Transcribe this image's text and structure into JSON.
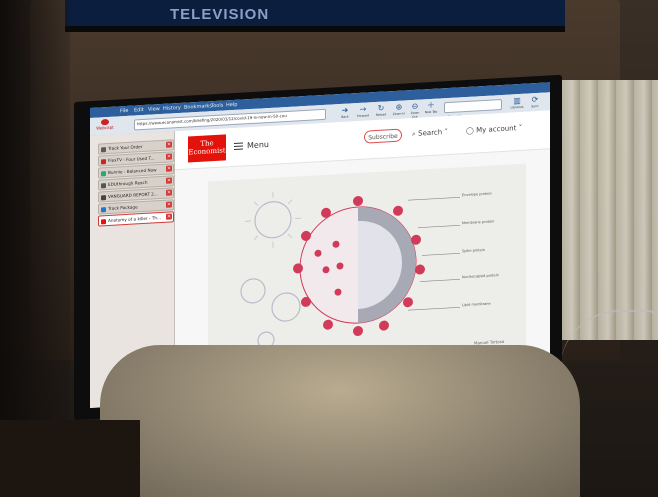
{
  "scene": {
    "tv_banner": "TELEVISION"
  },
  "browser": {
    "menu": [
      "File",
      "Edit",
      "View",
      "History",
      "Bookmarks",
      "Tools",
      "Help"
    ],
    "webcapture_label": "Webcapt",
    "url": "https://www.economist.com/briefing/2020/03/12/covid-19-is-now-in-50-countries-and-things-will-get-worse",
    "toolbar_buttons": [
      "Back",
      "Forward",
      "Reload",
      "Zoom In",
      "Zoom Out",
      "New Tab"
    ],
    "search_placeholder": "Search",
    "right_buttons": [
      "Libraries",
      "Sync"
    ]
  },
  "sidebar": {
    "items": [
      {
        "label": "Track Your Order",
        "color": "#5a5a5a"
      },
      {
        "label": "FlexTV - Four Used T...",
        "color": "#c22"
      },
      {
        "label": "Bunnie - Balanced Now",
        "color": "#2a7"
      },
      {
        "label": "EDUthrough Reach",
        "color": "#555"
      },
      {
        "label": "VANGUARD REPORT 2...",
        "color": "#444"
      },
      {
        "label": "Track Package",
        "color": "#27c"
      },
      {
        "label": "Anatomy of a killer - Th...",
        "color": "#e3120b",
        "active": true
      }
    ]
  },
  "page": {
    "logo_line1": "The",
    "logo_line2": "Economist",
    "menu_label": "Menu",
    "subscribe_label": "Subscribe",
    "search_label": "Search",
    "account_label": "My account",
    "figure_labels": [
      "Envelope protein",
      "Membrane protein",
      "Spike protein",
      "Nucleocapsid protein",
      "Lipid membrane"
    ],
    "figure_credit": "Manuel Tortosa"
  },
  "colors": {
    "economist_red": "#e3120b",
    "virus_pink": "#d23a5a",
    "browser_blue": "#2c5f9b"
  }
}
